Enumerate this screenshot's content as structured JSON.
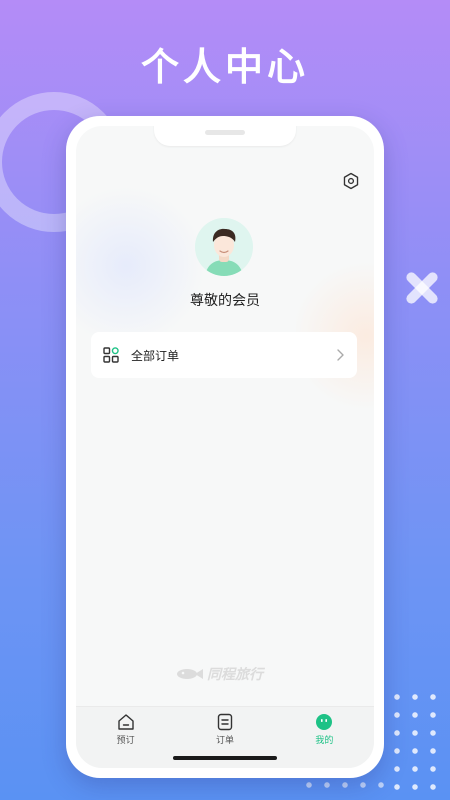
{
  "promo": {
    "headline": "个人中心"
  },
  "profile": {
    "name": "尊敬的会员",
    "settings_icon": "settings-gear-icon",
    "avatar_icon": "user-avatar-icon"
  },
  "orders_entry": {
    "label": "全部订单",
    "icon": "grid-apps-icon",
    "chevron": "chevron-right-icon"
  },
  "brand": {
    "logo_text": "同程旅行"
  },
  "tabbar": {
    "items": [
      {
        "label": "预订",
        "icon": "home-icon",
        "active": false
      },
      {
        "label": "订单",
        "icon": "order-list-icon",
        "active": false
      },
      {
        "label": "我的",
        "icon": "profile-face-icon",
        "active": true
      }
    ]
  },
  "colors": {
    "accent": "#1ec286",
    "bg_top": "#b48cf7",
    "bg_bottom": "#5a92f3",
    "screen_bg": "#f7f8f8"
  }
}
